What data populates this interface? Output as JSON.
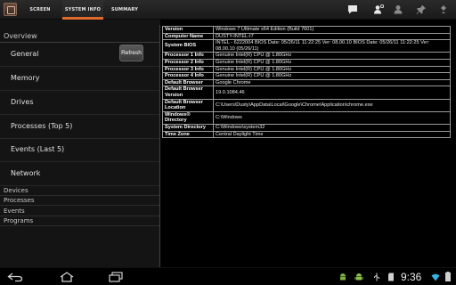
{
  "actionbar": {
    "tabs": [
      {
        "label": "SCREEN SHARING"
      },
      {
        "label": "SYSTEM INFO"
      },
      {
        "label": "SUMMARY"
      }
    ],
    "active_tab": "SYSTEM INFO",
    "accent_color": "#e06a2a",
    "icons": [
      "chat-icon",
      "user-gear-icon",
      "user-icon",
      "pin-icon",
      "overflow-menu-icon"
    ]
  },
  "sidebar": {
    "overview_label": "Overview",
    "group_items": [
      {
        "label": "General"
      },
      {
        "label": "Memory"
      },
      {
        "label": "Drives"
      },
      {
        "label": "Processes (Top 5)"
      },
      {
        "label": "Events (Last 5)"
      },
      {
        "label": "Network"
      }
    ],
    "refresh_label": "Refresh",
    "sections": [
      {
        "label": "Devices"
      },
      {
        "label": "Processes"
      },
      {
        "label": "Events"
      },
      {
        "label": "Programs"
      }
    ]
  },
  "sysinfo": {
    "rows": [
      {
        "key": "Version",
        "value": "Windows 7 Ultimate x64 Edition (Build 7601)"
      },
      {
        "key": "Computer Name",
        "value": "DUSTY-INTEL-I7"
      },
      {
        "key": "System BIOS",
        "value": "INTEL - 6222004 BIOS Date: 05/26/11 11:22:25 Ver: 08.00.10 BIOS Date: 05/26/11 11:22:25 Ver: 08.00.10 (05/26/11)"
      },
      {
        "key": "Processor 1 Info",
        "value": "Genuine Intel(R) CPU @ 1.80GHz"
      },
      {
        "key": "Processor 2 Info",
        "value": "Genuine Intel(R) CPU @ 1.80GHz"
      },
      {
        "key": "Processor 3 Info",
        "value": "Genuine Intel(R) CPU @ 1.80GHz"
      },
      {
        "key": "Processor 4 Info",
        "value": "Genuine Intel(R) CPU @ 1.80GHz"
      },
      {
        "key": "Default Browser",
        "value": "Google Chrome"
      },
      {
        "key": "Default Browser Version",
        "value": "19.0.1084.46"
      },
      {
        "key": "Default Browser Location",
        "value": "C:\\Users\\Dusty\\AppData\\Local\\Google\\Chrome\\Application\\chrome.exe"
      },
      {
        "key": "Windows® Directory",
        "value": "C:\\Windows"
      },
      {
        "key": "System Directory",
        "value": "C:\\Windows\\system32"
      },
      {
        "key": "Time Zone",
        "value": "Central Daylight Time"
      }
    ]
  },
  "systembar": {
    "clock": "9:36",
    "icons": [
      "back-icon",
      "home-icon",
      "recent-apps-icon",
      "android-icon",
      "android-debug-icon",
      "usb-icon",
      "sdcard-icon",
      "wifi-icon",
      "battery-icon"
    ]
  }
}
